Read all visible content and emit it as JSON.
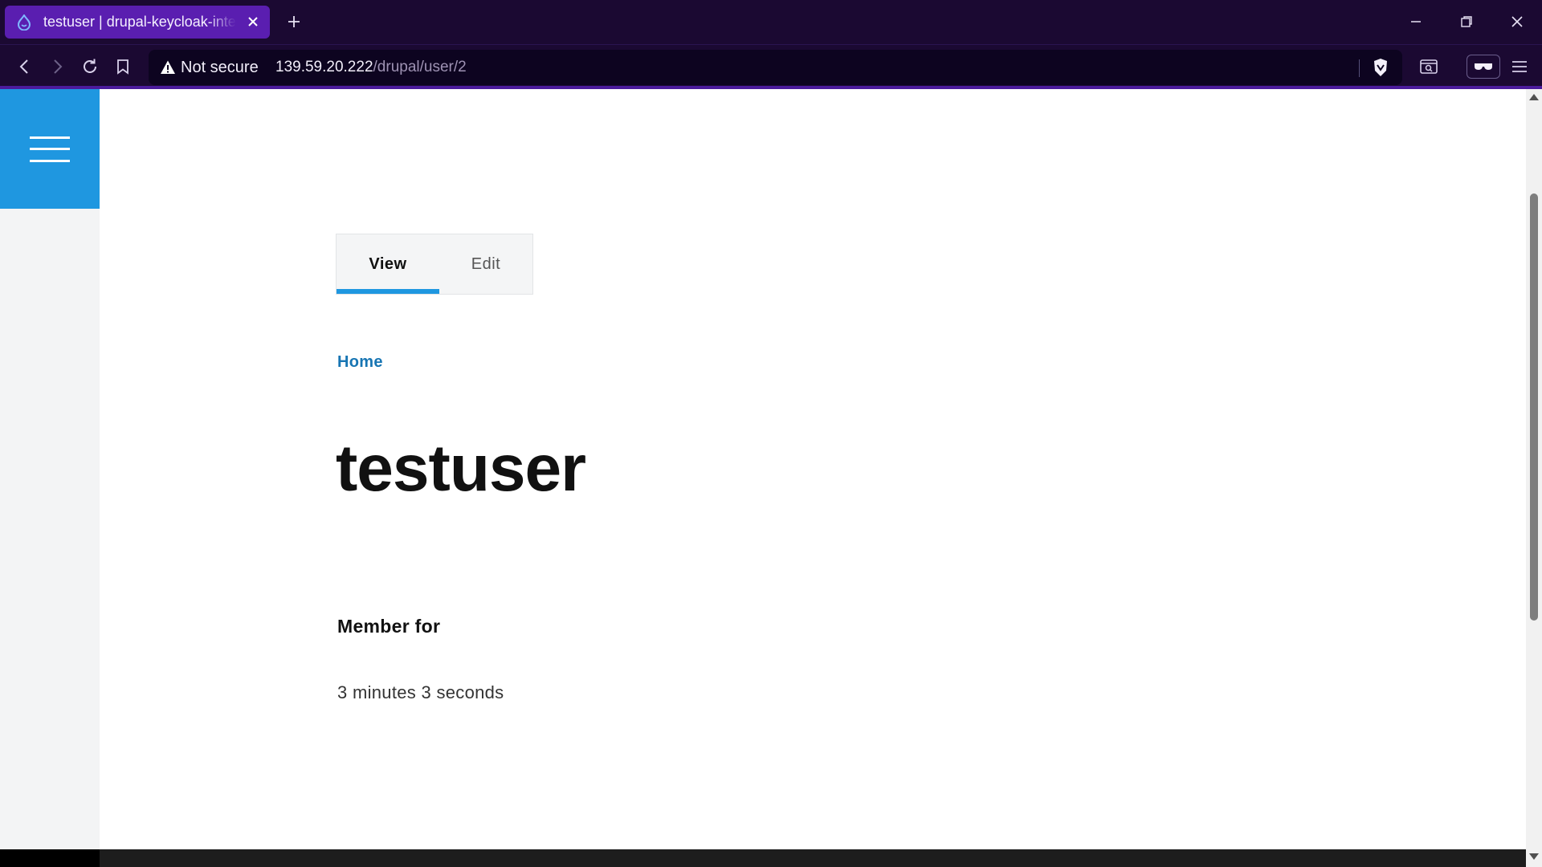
{
  "browser": {
    "tab": {
      "title": "testuser | drupal-keycloak-integr",
      "favicon": "drupal-drop-icon"
    },
    "omnibox": {
      "security_label": "Not secure",
      "url_host": "139.59.20.222",
      "url_path": "/drupal/user/2"
    }
  },
  "page": {
    "tabs": [
      {
        "label": "View",
        "active": true
      },
      {
        "label": "Edit",
        "active": false
      }
    ],
    "breadcrumb": "Home",
    "title": "testuser",
    "fields": [
      {
        "label": "Member for",
        "value": "3 minutes 3 seconds"
      }
    ]
  },
  "colors": {
    "chrome_bg": "#1b0932",
    "tab_active": "#5a1eb0",
    "accent_blue": "#1f97e0",
    "link_blue": "#1775b3"
  }
}
